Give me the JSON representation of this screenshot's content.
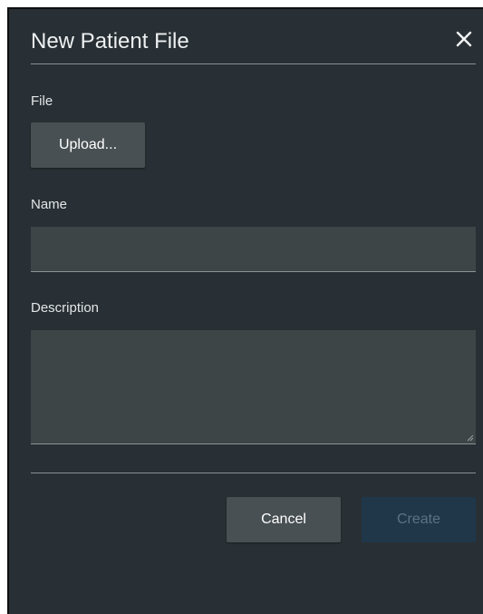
{
  "dialog": {
    "title": "New Patient File",
    "close_icon": "close-icon"
  },
  "form": {
    "file_label": "File",
    "upload_label": "Upload...",
    "name_label": "Name",
    "name_value": "",
    "description_label": "Description",
    "description_value": ""
  },
  "footer": {
    "cancel_label": "Cancel",
    "create_label": "Create",
    "create_disabled": true
  },
  "colors": {
    "background": "#283035",
    "input_background": "#3d4547",
    "button_background": "#485054",
    "create_disabled_background": "#1f3749",
    "create_disabled_text": "#5d7282"
  }
}
